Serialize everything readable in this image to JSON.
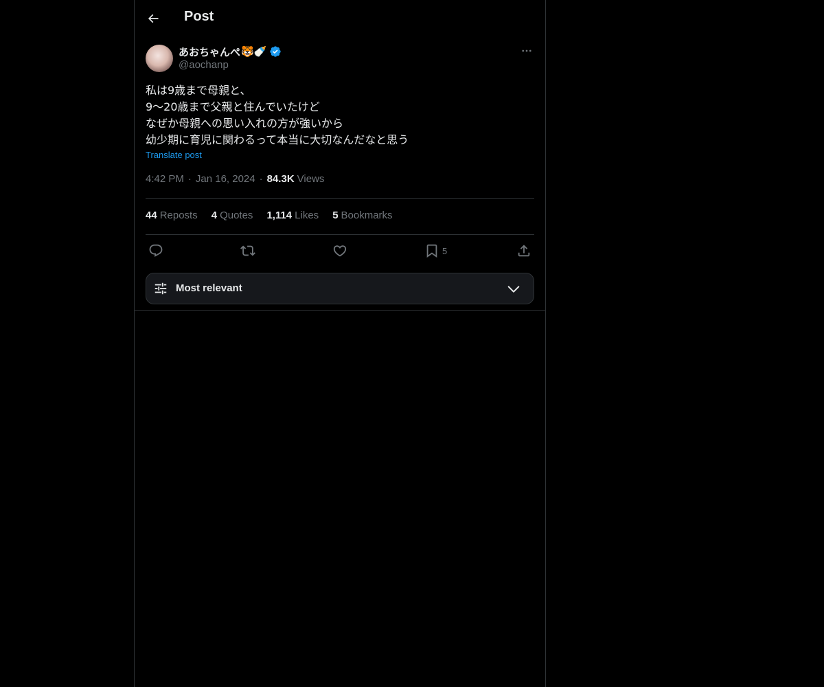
{
  "header": {
    "title": "Post"
  },
  "post": {
    "author": {
      "display_name": "あおちゃんぺ",
      "emojis": "🐯🍼",
      "handle": "@aochanp",
      "verified": true
    },
    "text_lines": [
      "私は9歳まで母親と、",
      "9〜20歳まで父親と住んでいたけど",
      "なぜか母親への思い入れの方が強いから",
      "幼少期に育児に関わるって本当に大切なんだなと思う"
    ],
    "translate_label": "Translate post",
    "time": "4:42 PM",
    "date": "Jan 16, 2024",
    "separator": "·",
    "views_count": "84.3K",
    "views_label": "Views",
    "stats": {
      "reposts_count": "44",
      "reposts_label": "Reposts",
      "quotes_count": "4",
      "quotes_label": "Quotes",
      "likes_count": "1,114",
      "likes_label": "Likes",
      "bookmarks_count": "5",
      "bookmarks_label": "Bookmarks"
    },
    "actions": {
      "bookmark_count": "5"
    }
  },
  "replies": {
    "sort_label": "Most relevant"
  },
  "colors": {
    "background": "#000000",
    "text": "#e7e9ea",
    "secondary": "#71767b",
    "accent": "#1d9bf0",
    "border": "#2f3336"
  },
  "icons": {
    "back": "arrow-left-icon",
    "more": "more-horizontal-icon",
    "verified": "verified-badge-icon",
    "reply": "reply-icon",
    "repost": "repost-icon",
    "like": "heart-icon",
    "bookmark": "bookmark-icon",
    "share": "share-icon",
    "sort": "sliders-icon",
    "chevron": "chevron-down-icon"
  }
}
